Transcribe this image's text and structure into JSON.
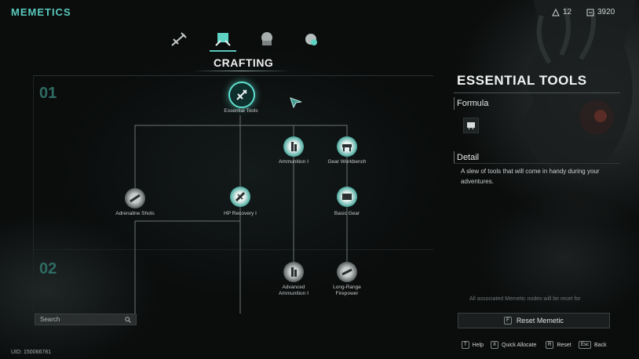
{
  "header": {
    "title": "MEMETICS",
    "currency_1": "12",
    "currency_2": "3920"
  },
  "tabs": [
    {
      "name": "weapons"
    },
    {
      "name": "crafting",
      "active": true
    },
    {
      "name": "survival"
    },
    {
      "name": "combat"
    }
  ],
  "section": {
    "title": "CRAFTING"
  },
  "tiers": [
    "01",
    "02"
  ],
  "nodes": {
    "essential_tools": "Essential Tools",
    "ammunition_1": "Ammunition Ⅰ",
    "gear_workbench": "Gear Workbench",
    "adrenaline_shots": "Adrenaline Shots",
    "hp_recovery_1": "HP Recovery Ⅰ",
    "basic_gear": "Basic Gear",
    "advanced_ammunition_1_line1": "Advanced",
    "advanced_ammunition_1_line2": "Ammunition Ⅰ",
    "long_range_firepower_line1": "Long-Range",
    "long_range_firepower_line2": "Firepower"
  },
  "search": {
    "placeholder": "Search"
  },
  "uid": "UID: 150066781",
  "detail": {
    "title": "ESSENTIAL TOOLS",
    "formula_label": "Formula",
    "detail_label": "Detail",
    "description": "A slew of tools that will come in handy during your adventures.",
    "reset_note": "All associated Memetic nodes will be reset for",
    "reset_key": "F",
    "reset_label": "Reset Memetic"
  },
  "hints": [
    {
      "key": "T",
      "label": "Help"
    },
    {
      "key": "X",
      "label": "Quick Allocate"
    },
    {
      "key": "R",
      "label": "Reset"
    },
    {
      "key": "Esc",
      "label": "Back"
    }
  ],
  "colors": {
    "accent": "#58c7b9",
    "background": "#0b0d0d",
    "node_active": "#49a89d",
    "node_locked": "#4b5151"
  }
}
